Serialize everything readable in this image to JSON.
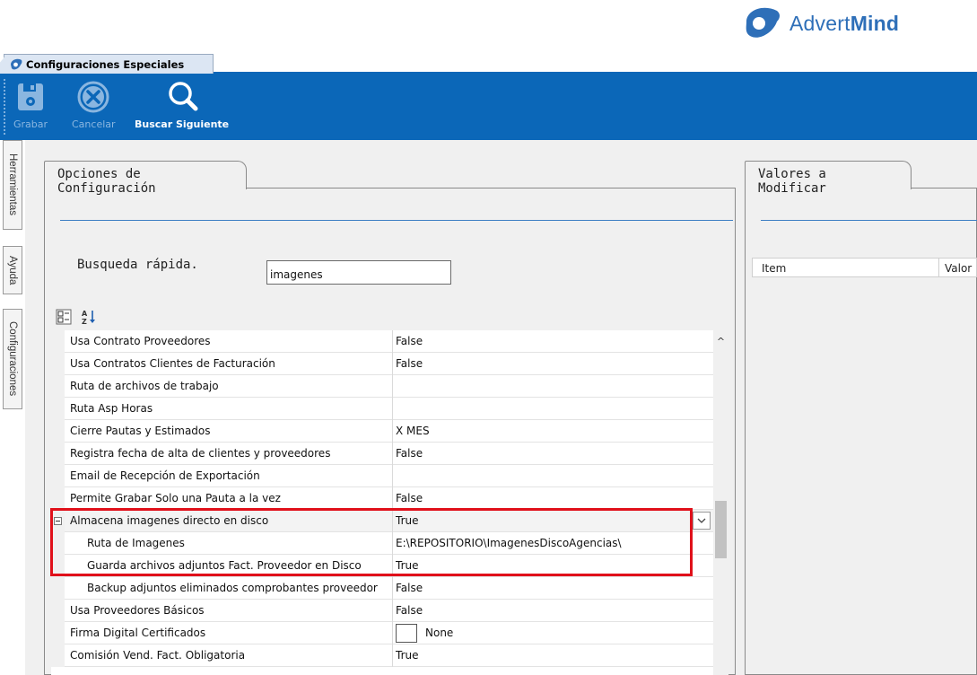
{
  "brand": {
    "name_light": "Advert",
    "name_bold": "Mind",
    "color": "#2e6fb8"
  },
  "window_tab": {
    "title": "Configuraciones Especiales"
  },
  "ribbon": {
    "color": "#0b67b8",
    "buttons": [
      {
        "label": "Grabar",
        "icon": "floppy-disk-icon",
        "enabled": false
      },
      {
        "label": "Cancelar",
        "icon": "cancel-x-icon",
        "enabled": false
      },
      {
        "label": "Buscar Siguiente",
        "icon": "magnifier-icon",
        "enabled": true
      }
    ]
  },
  "side_tabs": [
    "Herramientas",
    "Ayuda",
    "Configuraciones"
  ],
  "left_panel": {
    "tab_title": "Opciones de Configuración",
    "search_label": "Busqueda rápida.",
    "search_value": "imagenes",
    "toolbar": [
      "categorized-view-icon",
      "alphabetical-sort-icon"
    ],
    "rows": [
      {
        "name": "Usa Contrato Proveedores",
        "value": "False"
      },
      {
        "name": "Usa Contratos Clientes de Facturación",
        "value": "False"
      },
      {
        "name": "Ruta de archivos de trabajo",
        "value": ""
      },
      {
        "name": "Ruta Asp Horas",
        "value": ""
      },
      {
        "name": "Cierre Pautas y Estimados",
        "value": "X MES"
      },
      {
        "name": "Registra fecha de alta de clientes y proveedores",
        "value": "False"
      },
      {
        "name": "Email de Recepción de Exportación",
        "value": ""
      },
      {
        "name": "Permite Grabar Solo una Pauta a la vez",
        "value": "False"
      },
      {
        "name": "Almacena imagenes directo en disco",
        "value": "True",
        "expanded": true,
        "selected": true
      },
      {
        "name": "Ruta de Imagenes",
        "value": "E:\\REPOSITORIO\\ImagenesDiscoAgencias\\",
        "child": true
      },
      {
        "name": "Guarda archivos adjuntos Fact. Proveedor en Disco",
        "value": "True",
        "child": true
      },
      {
        "name": "Backup adjuntos eliminados comprobantes proveedor",
        "value": "False",
        "child": true
      },
      {
        "name": "Usa Proveedores Básicos",
        "value": "False"
      },
      {
        "name": "Firma Digital Certificados",
        "value": "None",
        "checkbox": true
      },
      {
        "name": "Comisión Vend. Fact. Obligatoria",
        "value": "True"
      }
    ]
  },
  "right_panel": {
    "tab_title": "Valores a Modificar",
    "columns": [
      "Item",
      "Valor"
    ]
  }
}
